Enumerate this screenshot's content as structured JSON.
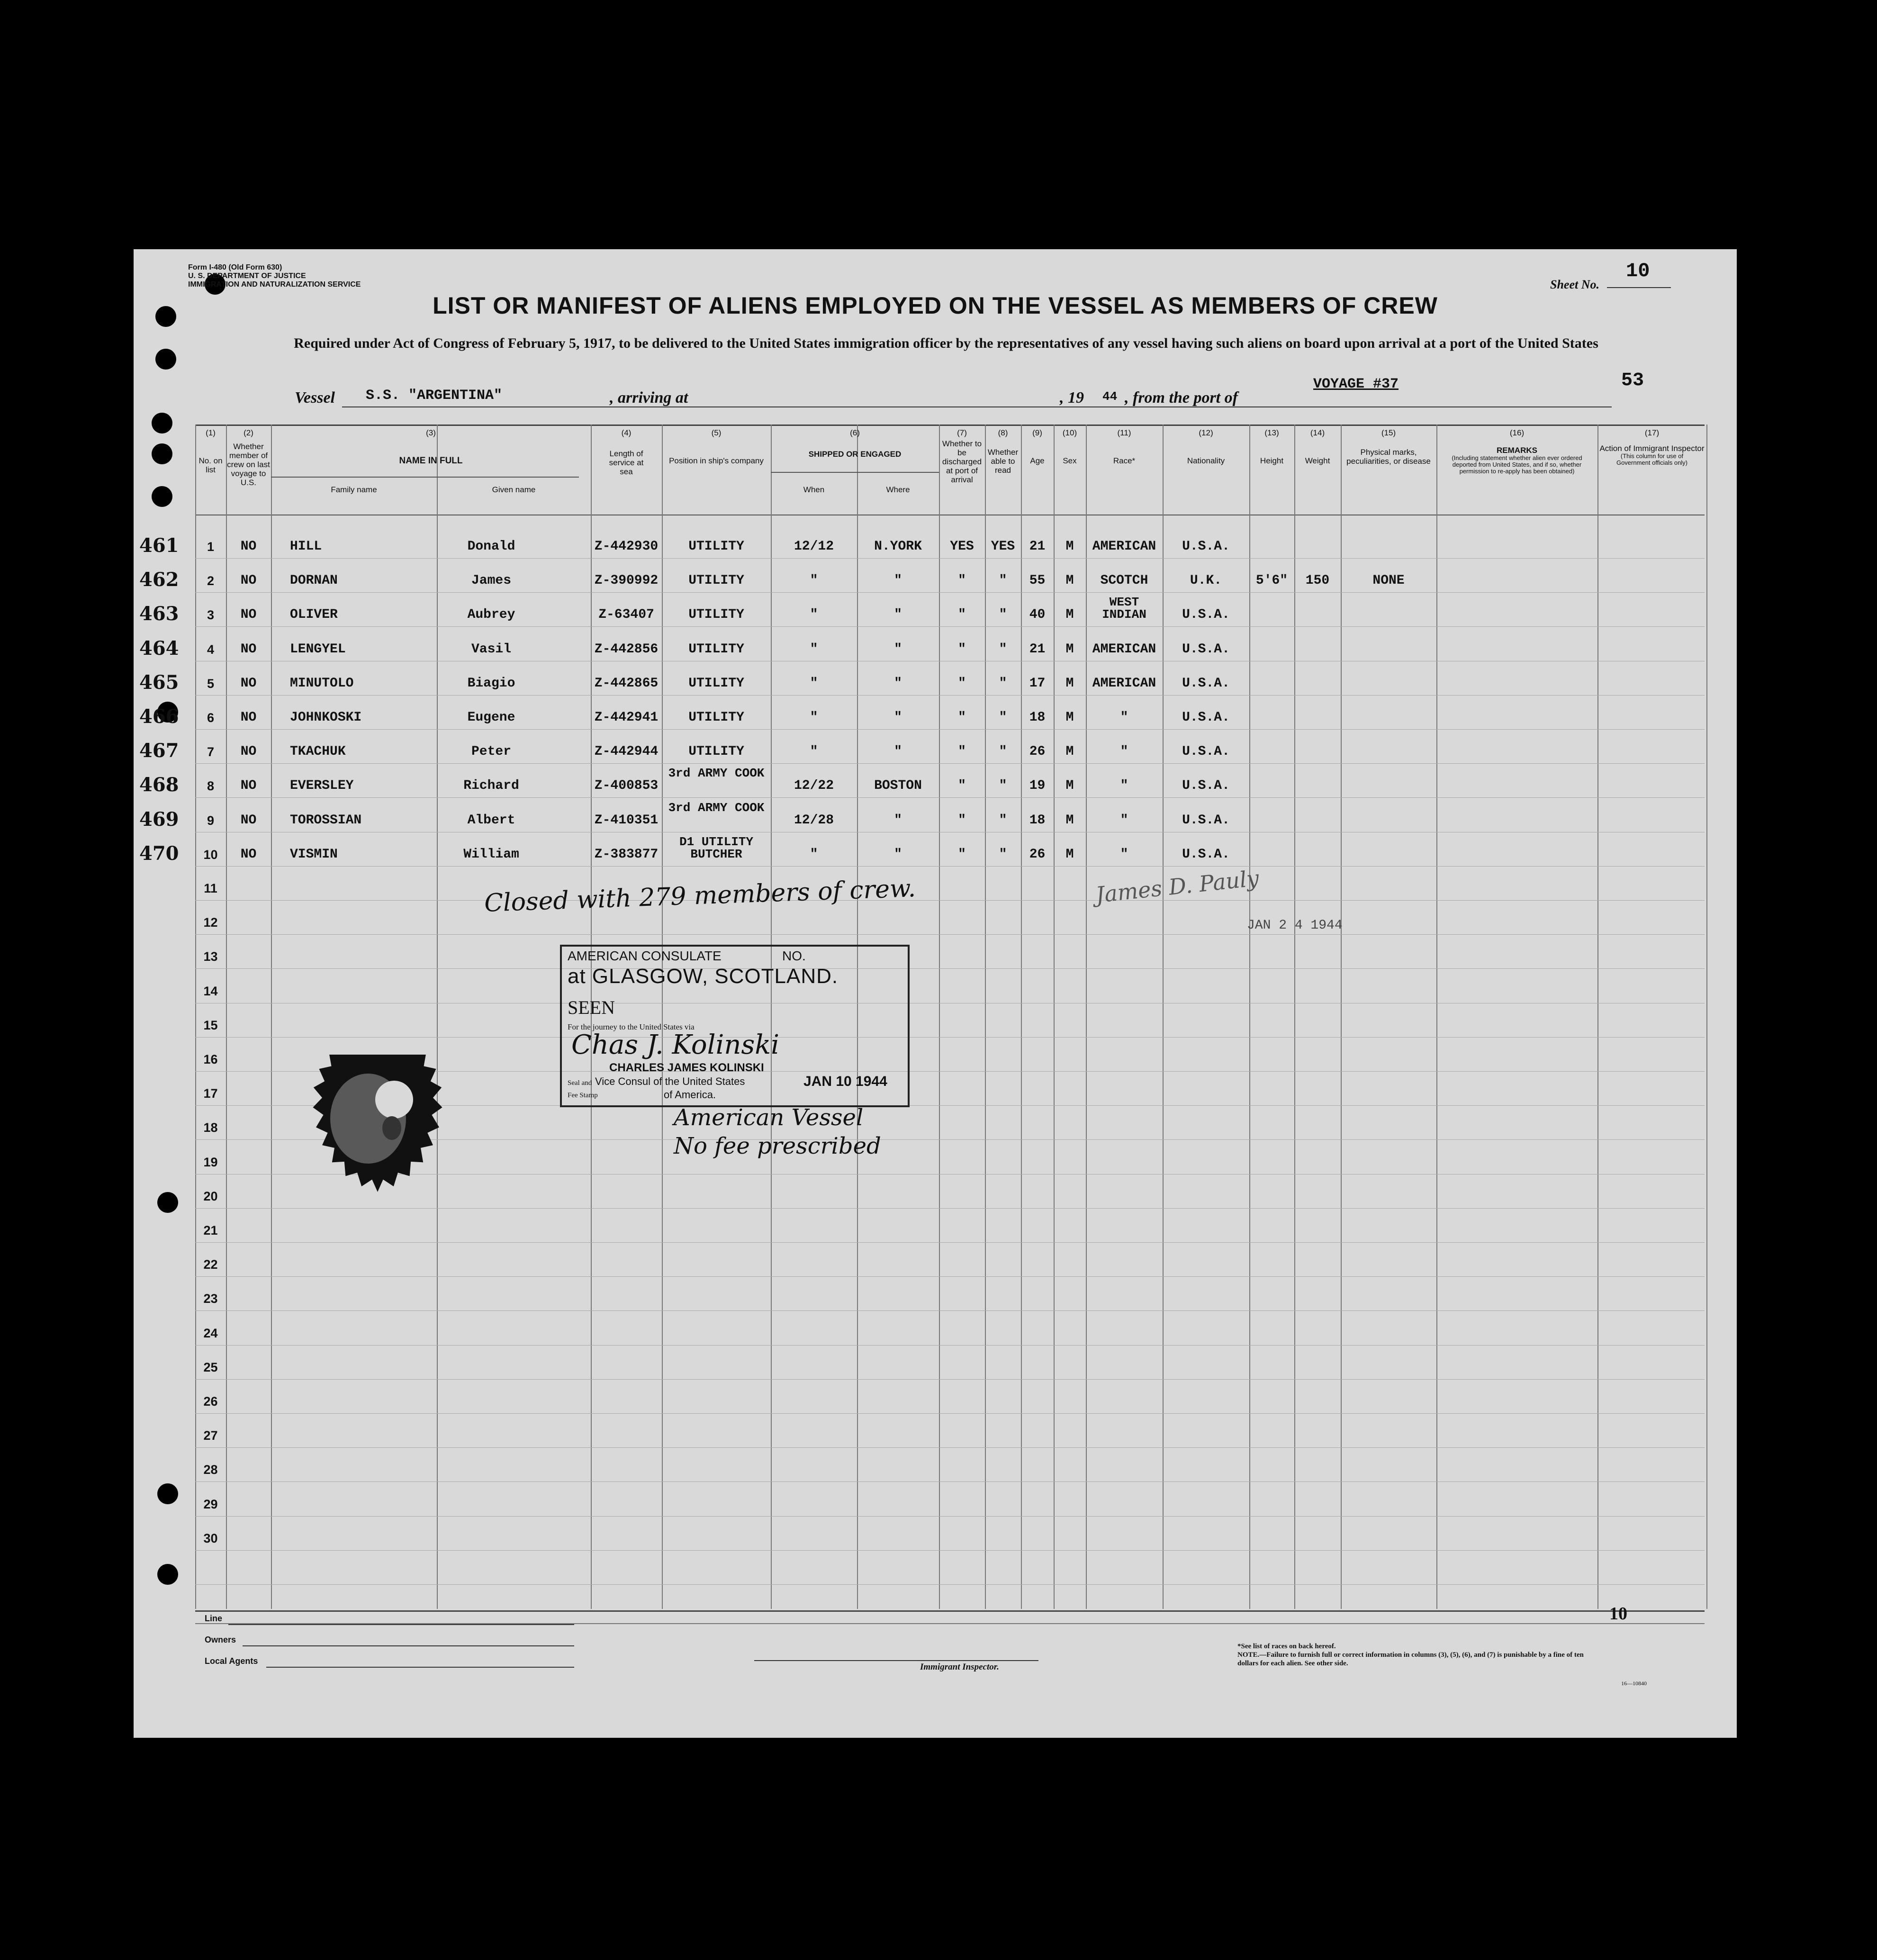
{
  "form": {
    "form_no": "Form I-480 (Old Form 630)",
    "dept": "U. S. DEPARTMENT OF JUSTICE",
    "service": "IMMIGRATION AND NATURALIZATION SERVICE",
    "sheet_label": "Sheet No.",
    "sheet_no": "10",
    "corner_no": "53",
    "title": "LIST OR MANIFEST OF ALIENS EMPLOYED ON THE VESSEL AS MEMBERS OF CREW",
    "subtitle": "Required under Act of Congress of February 5, 1917, to be delivered to the United States immigration officer by the representatives of any vessel having such aliens on board upon arrival at a port of the United States",
    "vessel_label": "Vessel",
    "vessel": "S.S. \"ARGENTINA\"",
    "arriving_label": ", arriving at",
    "year_prefix": ", 19",
    "year": "44",
    "port_label": ", from the port of",
    "voyage": "VOYAGE #37"
  },
  "headers": {
    "c1": "No. on list",
    "c2": "Whether member of crew on last voyage to U.S.",
    "c3": "NAME IN FULL",
    "c3a": "Family name",
    "c3b": "Given name",
    "c4": "Length of service at sea",
    "c5": "Position in ship's company",
    "c6": "SHIPPED OR ENGAGED",
    "c6a": "When",
    "c6b": "Where",
    "c7": "Whether to be discharged at port of arrival",
    "c8": "Whether able to read",
    "c9": "Age",
    "c10": "Sex",
    "c11": "Race*",
    "c12": "Nationality",
    "c13": "Height",
    "c14": "Weight",
    "c15": "Physical marks, peculiarities, or disease",
    "c16": "REMARKS",
    "c16_note": "(Including statement whether alien ever ordered deported from United States, and if so, whether permission to re-apply has been obtained)",
    "c17": "Action of Immigrant Inspector",
    "c17_note": "(This column for use of Government officials only)",
    "nums": [
      "(1)",
      "(2)",
      "(3)",
      "(4)",
      "(5)",
      "(6)",
      "(7)",
      "(8)",
      "(9)",
      "(10)",
      "(11)",
      "(12)",
      "(13)",
      "(14)",
      "(15)",
      "(16)",
      "(17)"
    ]
  },
  "rows": [
    {
      "ref": "461",
      "no": "1",
      "prev": "NO",
      "family": "HILL",
      "given": "Donald",
      "service": "Z-442930",
      "position": "UTILITY",
      "when": "12/12",
      "where": "N.YORK",
      "disch": "YES",
      "read": "YES",
      "age": "21",
      "sex": "M",
      "race": "AMERICAN",
      "nat": "U.S.A.",
      "height": "",
      "weight": "",
      "marks": ""
    },
    {
      "ref": "462",
      "no": "2",
      "prev": "NO",
      "family": "DORNAN",
      "given": "James",
      "service": "Z-390992",
      "position": "UTILITY",
      "when": "\"",
      "where": "\"",
      "disch": "\"",
      "read": "\"",
      "age": "55",
      "sex": "M",
      "race": "SCOTCH",
      "nat": "U.K.",
      "height": "5'6\"",
      "weight": "150",
      "marks": "NONE"
    },
    {
      "ref": "463",
      "no": "3",
      "prev": "NO",
      "family": "OLIVER",
      "given": "Aubrey",
      "service": "Z-63407",
      "position": "UTILITY",
      "when": "\"",
      "where": "\"",
      "disch": "\"",
      "read": "\"",
      "age": "40",
      "sex": "M",
      "race": "WEST INDIAN",
      "nat": "U.S.A.",
      "height": "",
      "weight": "",
      "marks": ""
    },
    {
      "ref": "464",
      "no": "4",
      "prev": "NO",
      "family": "LENGYEL",
      "given": "Vasil",
      "service": "Z-442856",
      "position": "UTILITY",
      "when": "\"",
      "where": "\"",
      "disch": "\"",
      "read": "\"",
      "age": "21",
      "sex": "M",
      "race": "AMERICAN",
      "nat": "U.S.A.",
      "height": "",
      "weight": "",
      "marks": ""
    },
    {
      "ref": "465",
      "no": "5",
      "prev": "NO",
      "family": "MINUTOLO",
      "given": "Biagio",
      "service": "Z-442865",
      "position": "UTILITY",
      "when": "\"",
      "where": "\"",
      "disch": "\"",
      "read": "\"",
      "age": "17",
      "sex": "M",
      "race": "AMERICAN",
      "nat": "U.S.A.",
      "height": "",
      "weight": "",
      "marks": ""
    },
    {
      "ref": "466",
      "no": "6",
      "prev": "NO",
      "family": "JOHNKOSKI",
      "given": "Eugene",
      "service": "Z-442941",
      "position": "UTILITY",
      "when": "\"",
      "where": "\"",
      "disch": "\"",
      "read": "\"",
      "age": "18",
      "sex": "M",
      "race": "\"",
      "nat": "U.S.A.",
      "height": "",
      "weight": "",
      "marks": ""
    },
    {
      "ref": "467",
      "no": "7",
      "prev": "NO",
      "family": "TKACHUK",
      "given": "Peter",
      "service": "Z-442944",
      "position": "UTILITY",
      "when": "\"",
      "where": "\"",
      "disch": "\"",
      "read": "\"",
      "age": "26",
      "sex": "M",
      "race": "\"",
      "nat": "U.S.A.",
      "height": "",
      "weight": "",
      "marks": ""
    },
    {
      "ref": "468",
      "no": "8",
      "prev": "NO",
      "family": "EVERSLEY",
      "given": "Richard",
      "service": "Z-400853",
      "position": "3rd ARMY COOK",
      "when": "12/22",
      "where": "BOSTON",
      "disch": "\"",
      "read": "\"",
      "age": "19",
      "sex": "M",
      "race": "\"",
      "nat": "U.S.A.",
      "height": "",
      "weight": "",
      "marks": ""
    },
    {
      "ref": "469",
      "no": "9",
      "prev": "NO",
      "family": "TOROSSIAN",
      "given": "Albert",
      "service": "Z-410351",
      "position": "3rd ARMY COOK",
      "when": "12/28",
      "where": "\"",
      "disch": "\"",
      "read": "\"",
      "age": "18",
      "sex": "M",
      "race": "\"",
      "nat": "U.S.A.",
      "height": "",
      "weight": "",
      "marks": ""
    },
    {
      "ref": "470",
      "no": "10",
      "prev": "NO",
      "family": "VISMIN",
      "given": "William",
      "service": "Z-383877",
      "position": "D1 UTILITY BUTCHER",
      "when": "\"",
      "where": "\"",
      "disch": "\"",
      "read": "\"",
      "age": "26",
      "sex": "M",
      "race": "\"",
      "nat": "U.S.A.",
      "height": "",
      "weight": "",
      "marks": ""
    }
  ],
  "blank_rows": [
    "11",
    "12",
    "13",
    "14",
    "15",
    "16",
    "17",
    "18",
    "19",
    "20",
    "21",
    "22",
    "23",
    "24",
    "25",
    "26",
    "27",
    "28",
    "29",
    "30"
  ],
  "annotations": {
    "closed_note": "Closed with 279 members of crew.",
    "signature": "James D. Pauly",
    "date_stamp": "JAN 2 4 1944"
  },
  "consulate_stamp": {
    "line1": "AMERICAN CONSULATE",
    "no_label": "NO.",
    "line2": "at GLASGOW, SCOTLAND.",
    "seen": "SEEN",
    "journey": "For the journey to the United States via",
    "consul_name": "CHARLES JAMES KOLINSKI",
    "consul_title": "Vice Consul of the United States",
    "of_america": "of America.",
    "date": "JAN 10 1944",
    "seal_label": "Seal and",
    "fee_label": "Fee Stamp",
    "hw1": "American Vessel",
    "hw2": "No fee prescribed"
  },
  "footer": {
    "line_label": "Line",
    "owners_label": "Owners",
    "agents_label": "Local Agents",
    "inspector_label": "Immigrant Inspector.",
    "sheet_no": "10",
    "note1": "*See list of races on back hereof.",
    "note2": "NOTE.—Failure to furnish full or correct information in columns (3), (5), (6), and (7) is punishable by a fine of ten dollars for each alien. See other side.",
    "code": "16—10840"
  }
}
